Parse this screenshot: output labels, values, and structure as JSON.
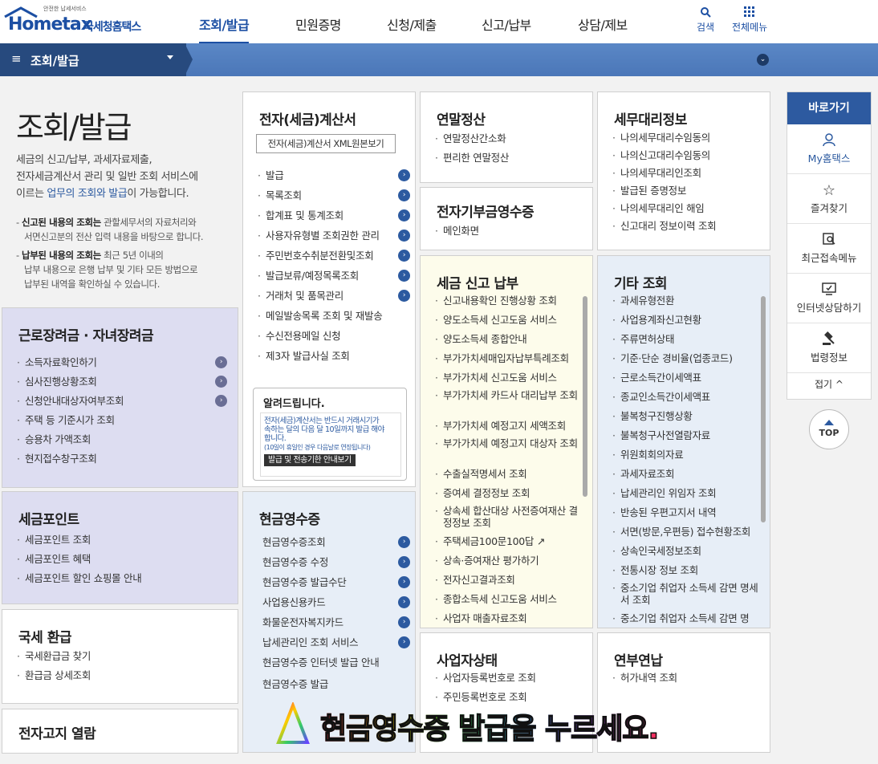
{
  "header": {
    "logo_small": "안전한 납세서비스",
    "logo_big": "Hometax",
    "logo_kr": "국세청홈택스",
    "nav": [
      "조회/발급",
      "민원증명",
      "신청/제출",
      "신고/납부",
      "상담/제보"
    ],
    "search": "검색",
    "allmenu": "전체메뉴"
  },
  "subbar": {
    "title": "조회/발급"
  },
  "intro": {
    "title": "조회/발급",
    "desc1": "세금의 신고/납부, 과세자료제출,",
    "desc2": "전자세금계산서 관리 및 일반 조회 서비스에",
    "desc3a": "이르는 ",
    "desc3hl": "업무의 조회와 발급",
    "desc3b": "이 가능합니다.",
    "note1_bold": "신고된 내용의 조회는",
    "note1_rest": " 관할세무서의 자료처리와",
    "note1_line2": "서면신고분의 전산 입력 내용을 바탕으로 합니다.",
    "note2_bold": "납부된 내용의 조회는",
    "note2_rest": " 최근 5년 이내의",
    "note2_line2": "납부 내용으로 은행 납부 및 기타 모든 방법으로",
    "note2_line3": "납부된 내역을 확인하실 수 있습니다."
  },
  "cards": {
    "earned": {
      "title": "근로장려금 · 자녀장려금",
      "items": [
        "소득자료확인하기",
        "심사진행상황조회",
        "신청안내대상자여부조회",
        "주택 등 기준시가 조회",
        "승용차 가액조회",
        "현지접수창구조회"
      ]
    },
    "points": {
      "title": "세금포인트",
      "items": [
        "세금포인트 조회",
        "세금포인트 혜택",
        "세금포인트 할인 쇼핑몰 안내"
      ]
    },
    "refund": {
      "title": "국세 환급",
      "items": [
        "국세환급금 찾기",
        "환급금 상세조회"
      ]
    },
    "enotice": {
      "title": "전자고지 열람"
    },
    "einvoice": {
      "title": "전자(세금)계산서",
      "xml_button": "전자(세금)계산서 XML원본보기",
      "items": [
        "발급",
        "목록조회",
        "합계표 및 통계조회",
        "사용자유형별 조회권한 관리",
        "주민번호수취분전환및조회",
        "발급보류/예정목록조회",
        "거래처 및 품목관리",
        "메일발송목록 조회 및 재발송",
        "수신전용메일 신청",
        "제3자 발급사실 조회"
      ]
    },
    "notice": {
      "title": "알려드립니다.",
      "line1": "전자(세금)계산서는 반드시 거래시기가",
      "line2": "속하는 달의 다음 달 10일까지 발급 해야",
      "line3": "합니다.",
      "line4": "(10일이 휴일인 경우 다음날로 연장됩니다)",
      "button": "발급 및 전송기한 안내보기"
    },
    "cash": {
      "title": "현금영수증",
      "items": [
        "현금영수증조회",
        "현금영수증 수정",
        "현금영수증 발급수단",
        "사업용신용카드",
        "화물운전자복지카드",
        "납세관리인 조회 서비스",
        "현금영수증 인터넷 발급 안내",
        "현금영수증 발급"
      ]
    },
    "yearend": {
      "title": "연말정산",
      "items": [
        "연말정산간소화",
        "편리한 연말정산"
      ]
    },
    "donation": {
      "title": "전자기부금영수증",
      "items": [
        "메인화면"
      ]
    },
    "taxreport": {
      "title": "세금 신고 납부",
      "items": [
        "신고내용확인 진행상황 조회",
        "양도소득세 신고도움 서비스",
        "양도소득세 종합안내",
        "부가가치세매입자납부특례조회",
        "부가가치세 신고도움 서비스",
        "부가가치세 카드사 대리납부 조회",
        "부가가치세 예정고지 세액조회",
        "부가가치세 예정고지 대상자 조회",
        "수출실적명세서 조회",
        "증여세 결정정보 조회",
        "상속세 합산대상 사전증여재산 결정정보 조회",
        "주택세금100문100답",
        "상속·증여재산 평가하기",
        "전자신고결과조회",
        "종합소득세 신고도움 서비스",
        "사업자 매출자료조회"
      ]
    },
    "bizstatus": {
      "title": "사업자상태",
      "items": [
        "사업자등록번호로 조회",
        "주민등록번호로 조회"
      ]
    },
    "agent": {
      "title": "세무대리정보",
      "items": [
        "나의세무대리수임동의",
        "나의신고대리수임동의",
        "나의세무대리인조회",
        "발급된 증명정보",
        "나의세무대리인 해임",
        "신고대리 정보이력 조회"
      ]
    },
    "other": {
      "title": "기타 조회",
      "items": [
        "과세유형전환",
        "사업용계좌신고현황",
        "주류면허상태",
        "기준·단순 경비율(업종코드)",
        "근로소득간이세액표",
        "종교인소득간이세액표",
        "불복청구진행상황",
        "불복청구사전열람자료",
        "위원회회의자료",
        "과세자료조회",
        "납세관리인 위임자 조회",
        "반송된 우편고지서 내역",
        "서면(방문,우편등) 접수현황조회",
        "상속인국세정보조회",
        "전통시장 정보 조회",
        "중소기업 취업자 소득세 감면 명세서 조회",
        "중소기업 취업자 소득세 감면 명"
      ]
    },
    "pension": {
      "title": "연부연납",
      "items": [
        "허가내역 조회"
      ]
    }
  },
  "side": {
    "head": "바로가기",
    "items": [
      "My홈택스",
      "즐겨찾기",
      "최근접속메뉴",
      "인터넷상담하기",
      "법령정보"
    ],
    "fold": "접기 ^",
    "top": "TOP"
  },
  "overlay": {
    "text": "현금영수증 발급을 누르세요."
  }
}
